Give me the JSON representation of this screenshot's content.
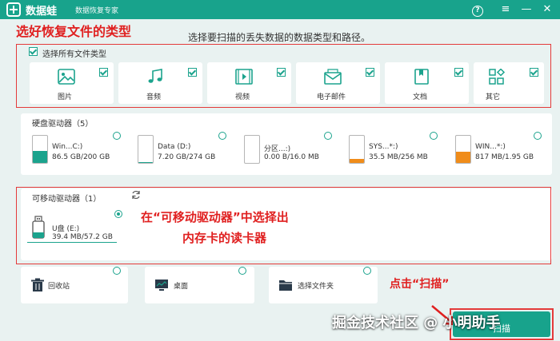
{
  "app": {
    "name": "数据蛙",
    "subtitle": "数据恢复专家"
  },
  "window": {
    "help": "?",
    "menu": "≡",
    "minimize": "—",
    "close": "✕"
  },
  "annotations": {
    "step1": "选好恢复文件的类型",
    "step2_line1": "在“可移动驱动器”中选择出",
    "step2_line2": "内存卡的读卡器",
    "step3": "点击“扫描”"
  },
  "prompt": "选择要扫描的丢失数据的数据类型和路径。",
  "file_types": {
    "select_all_label": "选择所有文件类型",
    "items": [
      {
        "label": "图片",
        "icon": "image-icon"
      },
      {
        "label": "音频",
        "icon": "music-icon"
      },
      {
        "label": "视频",
        "icon": "video-icon"
      },
      {
        "label": "电子邮件",
        "icon": "mail-icon"
      },
      {
        "label": "文档",
        "icon": "document-icon"
      },
      {
        "label": "其它",
        "icon": "other-icon"
      }
    ]
  },
  "hard_drives": {
    "header": "硬盘驱动器（5）",
    "items": [
      {
        "name": "Win...C:)",
        "size": "86.5 GB/200 GB",
        "used": 0.43,
        "color": "#1ba38d"
      },
      {
        "name": "Data (D:)",
        "size": "7.20 GB/274 GB",
        "used": 0.03,
        "color": "#1ba38d"
      },
      {
        "name": "分区...:)",
        "size": "0.00  B/16.0 MB",
        "used": 0.0,
        "color": "#1ba38d"
      },
      {
        "name": "SYS...*:)",
        "size": "35.5 MB/256 MB",
        "used": 0.14,
        "color": "#f08c1a"
      },
      {
        "name": "WIN...*:)",
        "size": "817 MB/1.95 GB",
        "used": 0.42,
        "color": "#f08c1a"
      }
    ]
  },
  "removable": {
    "header": "可移动驱动器（1）",
    "item": {
      "name": "U盘 (E:)",
      "size": "39.4 MB/57.2 GB"
    }
  },
  "locations": [
    {
      "label": "回收站",
      "icon": "trash-icon"
    },
    {
      "label": "桌面",
      "icon": "desktop-icon"
    },
    {
      "label": "选择文件夹",
      "icon": "folder-icon"
    }
  ],
  "scan_button": "扫描",
  "watermark": "掘金技术社区 @ 小明助手"
}
